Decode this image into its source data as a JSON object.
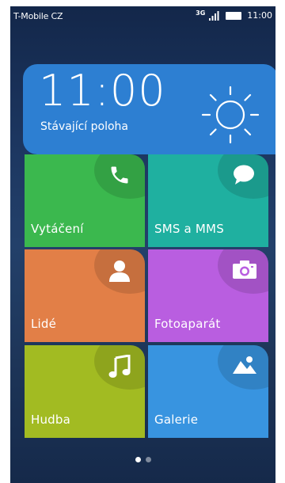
{
  "status_bar": {
    "carrier": "T-Mobile CZ",
    "network_type": "3G",
    "time": "11:00",
    "icons": [
      "signal-icon",
      "battery-icon"
    ]
  },
  "weather_widget": {
    "time": "11:00",
    "location": "Stávající poloha",
    "icon": "sun-icon",
    "color": "#2d7fd2"
  },
  "tiles": [
    {
      "label": "Vytáčení",
      "icon": "phone-icon",
      "color": "#3bb84e"
    },
    {
      "label": "SMS a MMS",
      "icon": "message-icon",
      "color": "#1fb0a0"
    },
    {
      "label": "Lidé",
      "icon": "contact-icon",
      "color": "#e27f47"
    },
    {
      "label": "Fotoaparát",
      "icon": "camera-icon",
      "color": "#b95ee0"
    },
    {
      "label": "Hudba",
      "icon": "music-icon",
      "color": "#a2bb22"
    },
    {
      "label": "Galerie",
      "icon": "gallery-icon",
      "color": "#3894e0"
    }
  ],
  "page_indicator": {
    "pages": 2,
    "current": 1
  }
}
